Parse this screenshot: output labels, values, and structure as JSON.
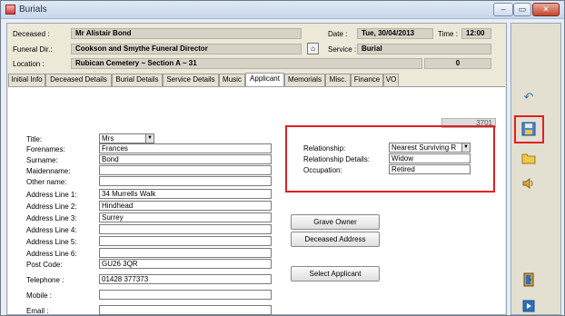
{
  "window": {
    "title": "Burials",
    "buttons": {
      "minimize": "–",
      "restore": "▭",
      "close": "✕"
    }
  },
  "header": {
    "deceased_label": "Deceased :",
    "deceased_value": "Mr Alistair Bond",
    "date_label": "Date :",
    "date_value": "Tue, 30/04/2013",
    "time_label": "Time :",
    "time_value": "12:00",
    "funeral_label": "Funeral Dir.:",
    "funeral_value": "Cookson and Smythe Funeral Director",
    "service_label": "Service :",
    "service_value": "Burial",
    "location_label": "Location :",
    "location_value": "Rubican Cemetery ~ Section A ~ 31",
    "location_num": "0"
  },
  "tabs": [
    "Initial Info",
    "Deceased Details",
    "Burial Details",
    "Service Details",
    "Music",
    "Applicant",
    "Memorials",
    "Misc.",
    "Finance",
    "VO"
  ],
  "active_tab": "Applicant",
  "form": {
    "record_id": "3701",
    "title_label": "Title:",
    "title_value": "Mrs",
    "forenames_label": "Forenames:",
    "forenames_value": "Frances",
    "surname_label": "Surname:",
    "surname_value": "Bond",
    "maidenname_label": "Maidenname:",
    "maidenname_value": "",
    "othername_label": "Other name:",
    "othername_value": "",
    "addr1_label": "Address Line 1:",
    "addr1_value": "34 Murrells Walk",
    "addr2_label": "Address Line 2:",
    "addr2_value": "Hindhead",
    "addr3_label": "Address Line 3:",
    "addr3_value": "Surrey",
    "addr4_label": "Address Line 4:",
    "addr4_value": "",
    "addr5_label": "Address Line 5:",
    "addr5_value": "",
    "addr6_label": "Address Line 6:",
    "addr6_value": "",
    "postcode_label": "Post Code:",
    "postcode_value": "GU26 3QR",
    "telephone_label": "Telephone :",
    "telephone_value": "01428 377373",
    "mobile_label": "Mobile :",
    "mobile_value": "",
    "email_label": "Email :",
    "email_value": "",
    "relationship_label": "Relationship:",
    "relationship_value": "Nearest Surviving R",
    "reldetails_label": "Relationship Details:",
    "reldetails_value": "Widow",
    "occupation_label": "Occupation:",
    "occupation_value": "Retired"
  },
  "buttons": {
    "grave_owner": "Grave Owner",
    "deceased_address": "Deceased Address",
    "select_applicant": "Select Applicant"
  },
  "colors": {
    "highlight": "#e02020",
    "accent": "#2f6fb5"
  },
  "sidebar_icons": [
    "undo-icon",
    "save-icon",
    "folder-icon",
    "speaker-icon",
    "exit-door-icon",
    "next-icon"
  ]
}
